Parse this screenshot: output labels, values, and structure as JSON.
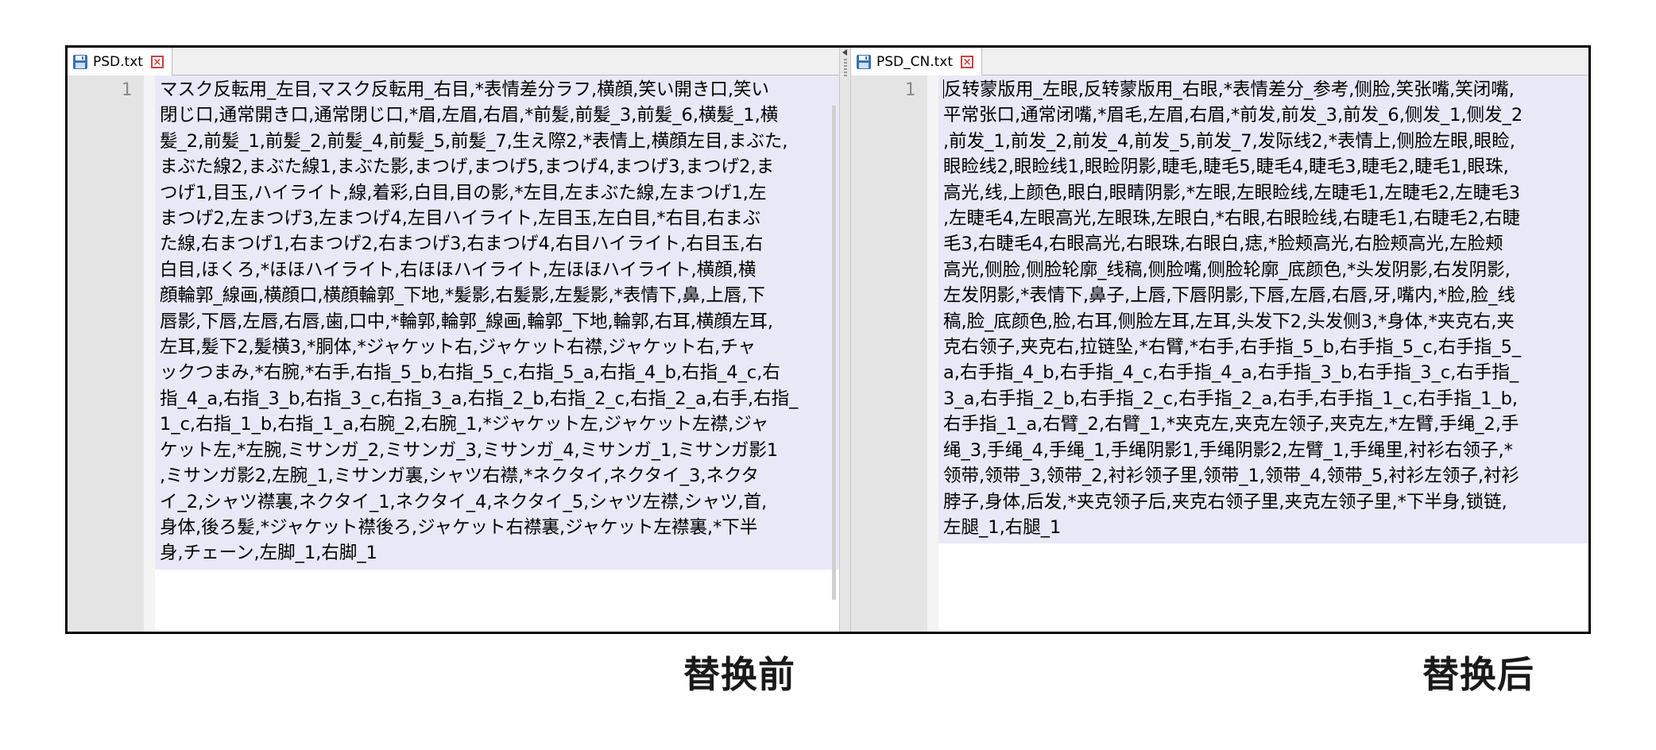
{
  "left_editor": {
    "tab_label": "PSD.txt",
    "close_label": "×",
    "line_number": "1",
    "lines": [
      "マスク反転用_左目,マスク反転用_右目,*表情差分ラフ,横顔,笑い開き口,笑い",
      "閉じ口,通常開き口,通常閉じ口,*眉,左眉,右眉,*前髪,前髪_3,前髪_6,横髪_1,横",
      "髪_2,前髪_1,前髪_2,前髪_4,前髪_5,前髪_7,生え際2,*表情上,横顔左目,まぶた,",
      "まぶた線2,まぶた線1,まぶた影,まつげ,まつげ5,まつげ4,まつげ3,まつげ2,ま",
      "つげ1,目玉,ハイライト,線,着彩,白目,目の影,*左目,左まぶた線,左まつげ1,左",
      "まつげ2,左まつげ3,左まつげ4,左目ハイライト,左目玉,左白目,*右目,右まぶ",
      "た線,右まつげ1,右まつげ2,右まつげ3,右まつげ4,右目ハイライト,右目玉,右",
      "白目,ほくろ,*ほほハイライト,右ほほハイライト,左ほほハイライト,横顔,横",
      "顔輪郭_線画,横顔口,横顔輪郭_下地,*髪影,右髪影,左髪影,*表情下,鼻,上唇,下",
      "唇影,下唇,左唇,右唇,歯,口中,*輪郭,輪郭_線画,輪郭_下地,輪郭,右耳,横顔左耳,",
      "左耳,髪下2,髪横3,*胴体,*ジャケット右,ジャケット右襟,ジャケット右,チャ",
      "ックつまみ,*右腕,*右手,右指_5_b,右指_5_c,右指_5_a,右指_4_b,右指_4_c,右",
      "指_4_a,右指_3_b,右指_3_c,右指_3_a,右指_2_b,右指_2_c,右指_2_a,右手,右指_",
      "1_c,右指_1_b,右指_1_a,右腕_2,右腕_1,*ジャケット左,ジャケット左襟,ジャ",
      "ケット左,*左腕,ミサンガ_2,ミサンガ_3,ミサンガ_4,ミサンガ_1,ミサンガ影1",
      ",ミサンガ影2,左腕_1,ミサンガ裏,シャツ右襟,*ネクタイ,ネクタイ_3,ネクタ",
      "イ_2,シャツ襟裏,ネクタイ_1,ネクタイ_4,ネクタイ_5,シャツ左襟,シャツ,首,",
      "身体,後ろ髪,*ジャケット襟後ろ,ジャケット右襟裏,ジャケット左襟裏,*下半",
      "身,チェーン,左脚_1,右脚_1"
    ]
  },
  "right_editor": {
    "tab_label": "PSD_CN.txt",
    "close_label": "×",
    "line_number": "1",
    "lines": [
      "反转蒙版用_左眼,反转蒙版用_右眼,*表情差分_参考,侧脸,笑张嘴,笑闭嘴,",
      "平常张口,通常闭嘴,*眉毛,左眉,右眉,*前发,前发_3,前发_6,侧发_1,侧发_2",
      ",前发_1,前发_2,前发_4,前发_5,前发_7,发际线2,*表情上,侧脸左眼,眼睑,",
      "眼睑线2,眼睑线1,眼睑阴影,睫毛,睫毛5,睫毛4,睫毛3,睫毛2,睫毛1,眼珠,",
      "高光,线,上颜色,眼白,眼睛阴影,*左眼,左眼睑线,左睫毛1,左睫毛2,左睫毛3",
      ",左睫毛4,左眼高光,左眼珠,左眼白,*右眼,右眼睑线,右睫毛1,右睫毛2,右睫",
      "毛3,右睫毛4,右眼高光,右眼珠,右眼白,痣,*脸颊高光,右脸颊高光,左脸颊",
      "高光,侧脸,侧脸轮廓_线稿,侧脸嘴,侧脸轮廓_底颜色,*头发阴影,右发阴影,",
      "左发阴影,*表情下,鼻子,上唇,下唇阴影,下唇,左唇,右唇,牙,嘴内,*脸,脸_线",
      "稿,脸_底颜色,脸,右耳,侧脸左耳,左耳,头发下2,头发侧3,*身体,*夹克右,夹",
      "克右领子,夹克右,拉链坠,*右臂,*右手,右手指_5_b,右手指_5_c,右手指_5_",
      "a,右手指_4_b,右手指_4_c,右手指_4_a,右手指_3_b,右手指_3_c,右手指_",
      "3_a,右手指_2_b,右手指_2_c,右手指_2_a,右手,右手指_1_c,右手指_1_b,",
      "右手指_1_a,右臂_2,右臂_1,*夹克左,夹克左领子,夹克左,*左臂,手绳_2,手",
      "绳_3,手绳_4,手绳_1,手绳阴影1,手绳阴影2,左臂_1,手绳里,衬衫右领子,*",
      "领带,领带_3,领带_2,衬衫领子里,领带_1,领带_4,领带_5,衬衫左领子,衬衫",
      "脖子,身体,后发,*夹克领子后,夹克右领子里,夹克左领子里,*下半身,锁链,",
      "左腿_1,右腿_1"
    ]
  },
  "captions": {
    "before": "替换前",
    "after": "替换后"
  },
  "colors": {
    "selection": "#e8e8f7",
    "gutter": "#e4e4e4",
    "close_icon": "#d04040"
  },
  "icons": {
    "tab_icon": "save-disk-icon",
    "close_icon": "close-icon"
  }
}
